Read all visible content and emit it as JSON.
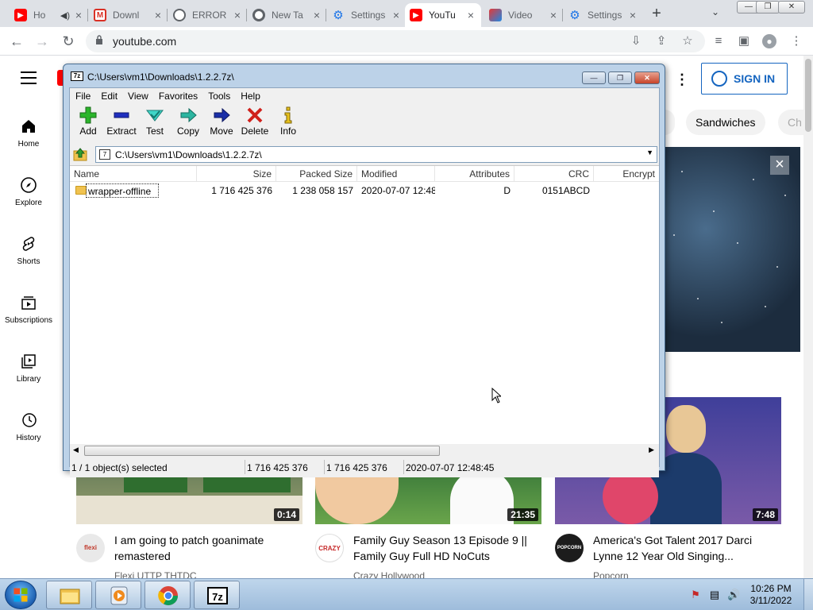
{
  "browser": {
    "tabs": [
      {
        "title": "Ho",
        "favicon": "youtube-icon",
        "audio": true
      },
      {
        "title": "Downl",
        "favicon": "gmail-icon"
      },
      {
        "title": "ERROR",
        "favicon": "globe-icon"
      },
      {
        "title": "New Ta",
        "favicon": "chrome-icon"
      },
      {
        "title": "Settings",
        "favicon": "gear-icon"
      },
      {
        "title": "YouTu",
        "favicon": "youtube-icon",
        "active": true
      },
      {
        "title": "Video",
        "favicon": "video-icon"
      },
      {
        "title": "Settings",
        "favicon": "gear-icon"
      }
    ],
    "url": "youtube.com"
  },
  "youtube": {
    "sign_in": "SIGN IN",
    "guide": [
      {
        "label": "Home",
        "icon": "home-icon"
      },
      {
        "label": "Explore",
        "icon": "compass-icon"
      },
      {
        "label": "Shorts",
        "icon": "shorts-icon"
      },
      {
        "label": "Subscriptions",
        "icon": "subscriptions-icon"
      },
      {
        "label": "Library",
        "icon": "library-icon"
      },
      {
        "label": "History",
        "icon": "history-icon"
      }
    ],
    "chips": [
      "Sandwiches",
      "Ch"
    ],
    "videos": [
      {
        "title": "I am going to patch goanimate remastered",
        "channel": "Flexi UTTP THTDC",
        "duration": "0:14",
        "avatar_text": "flexi"
      },
      {
        "title": "Family Guy Season 13 Episode 9 || Family Guy Full HD NoCuts",
        "channel": "Crazy Hollywood",
        "duration": "21:35",
        "avatar_text": "CRAZY"
      },
      {
        "title": "America's Got Talent 2017 Darci Lynne 12 Year Old Singing...",
        "channel": "Popcorn",
        "duration": "7:48",
        "avatar_text": "POPCORN"
      }
    ]
  },
  "sevenzip": {
    "title": "C:\\Users\\vm1\\Downloads\\1.2.2.7z\\",
    "menu": [
      "File",
      "Edit",
      "View",
      "Favorites",
      "Tools",
      "Help"
    ],
    "toolbar": [
      "Add",
      "Extract",
      "Test",
      "Copy",
      "Move",
      "Delete",
      "Info"
    ],
    "path": "C:\\Users\\vm1\\Downloads\\1.2.2.7z\\",
    "columns": [
      "Name",
      "Size",
      "Packed Size",
      "Modified",
      "Attributes",
      "CRC",
      "Encrypt"
    ],
    "rows": [
      {
        "name": "wrapper-offline",
        "size": "1 716 425 376",
        "packed": "1 238 058 157",
        "modified": "2020-07-07 12:48",
        "attributes": "D",
        "crc": "0151ABCD"
      }
    ],
    "status": {
      "selected": "1 / 1 object(s) selected",
      "size": "1 716 425 376",
      "packed": "1 716 425 376",
      "modified": "2020-07-07 12:48:45"
    }
  },
  "taskbar": {
    "apps": [
      "explorer-icon",
      "media-player-icon",
      "chrome-icon",
      "7zip-icon"
    ],
    "time": "10:26 PM",
    "date": "3/11/2022"
  }
}
